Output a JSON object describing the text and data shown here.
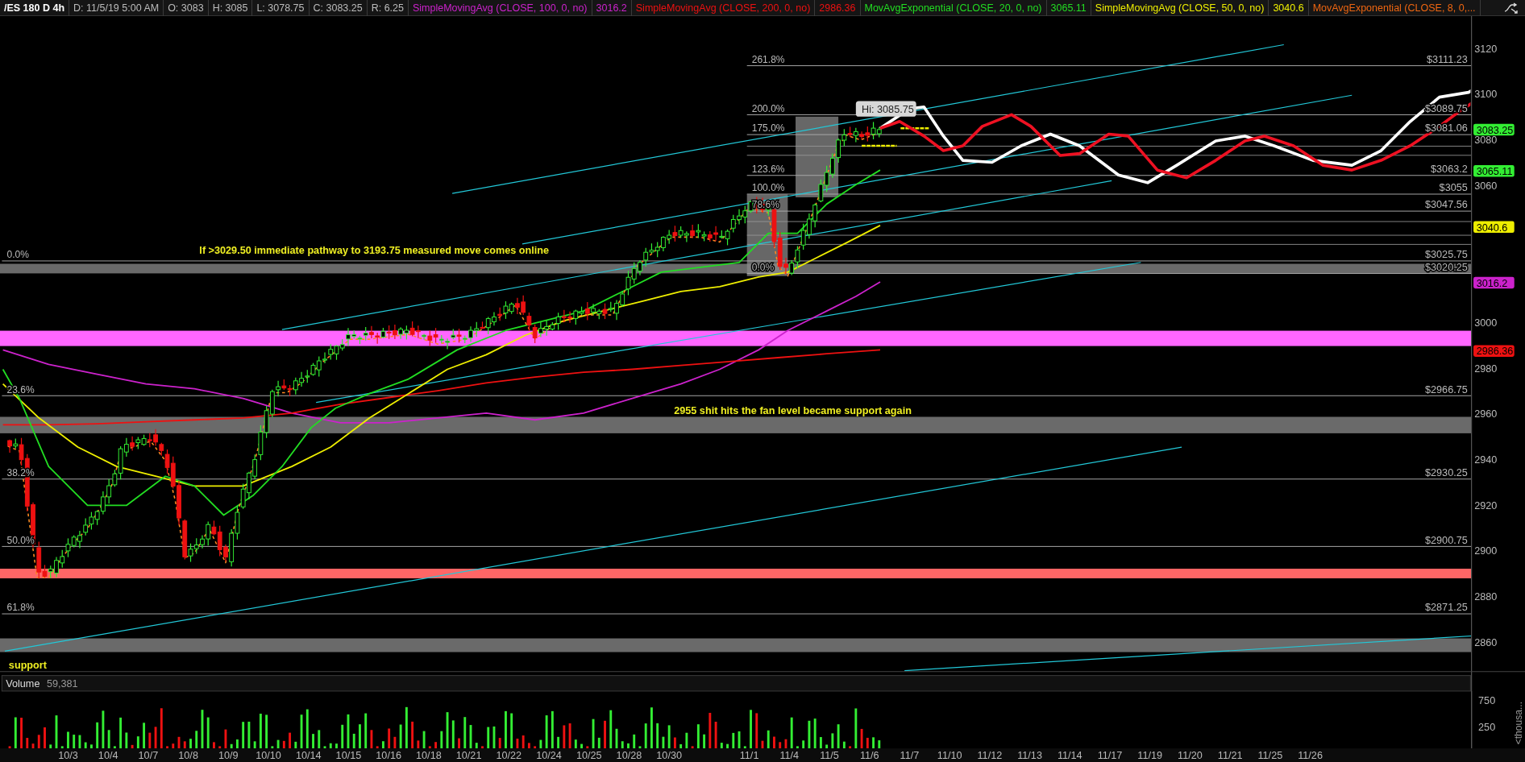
{
  "header": {
    "symbol": "/ES 180 D 4h",
    "fields": [
      "D: 11/5/19 5:00 AM",
      "O: 3083",
      "H: 3085",
      "L: 3078.75",
      "C: 3083.25",
      "R: 6.25"
    ],
    "studies": [
      {
        "label": "SimpleMovingAvg (CLOSE, 100, 0, no)",
        "value": "3016.2",
        "color": "#cc22cc"
      },
      {
        "label": "SimpleMovingAvg (CLOSE, 200, 0, no)",
        "value": "2986.36",
        "color": "#ee1111"
      },
      {
        "label": "MovAvgExponential (CLOSE, 20, 0, no)",
        "value": "3065.11",
        "color": "#22dd22"
      },
      {
        "label": "SimpleMovingAvg (CLOSE, 50, 0, no)",
        "value": "3040.6",
        "color": "#eeee00"
      },
      {
        "label": "MovAvgExponential (CLOSE, 8, 0,...",
        "color": "#ee6611"
      }
    ]
  },
  "fib_sets": [
    {
      "levels": [
        {
          "pct": "0.0%",
          "price": "$3025.75"
        },
        {
          "pct": "23.6%",
          "price": "$2966.75"
        },
        {
          "pct": "38.2%",
          "price": "$2930.25"
        },
        {
          "pct": "50.0%",
          "price": "$2900.75"
        },
        {
          "pct": "61.8%",
          "price": "$2871.25"
        }
      ]
    },
    {
      "levels": [
        {
          "pct": "261.8%",
          "price": "$3111.23"
        },
        {
          "pct": "200.0%",
          "price": "$3089.75"
        },
        {
          "pct": "175.0%",
          "price": "$3081.06"
        },
        {
          "pct": "123.6%",
          "price": "$3063.2"
        },
        {
          "pct": "100.0%",
          "price": "$3055"
        },
        {
          "pct": "78.6%",
          "price": "$3047.56"
        },
        {
          "pct": "0.0%",
          "price": "$3020.25"
        }
      ]
    }
  ],
  "annotations": [
    "If >3029.50 immediate pathway to 3193.75 measured move comes online",
    "2955 shit hits the fan level became support again",
    "support"
  ],
  "high_bubble": "Hi: 3085.75",
  "price_axis": {
    "ticks": [
      "3120",
      "3100",
      "3080",
      "3060",
      "3000",
      "2980",
      "2960",
      "2940",
      "2920",
      "2900",
      "2880",
      "2860"
    ]
  },
  "price_tags": [
    {
      "text": "3083.25",
      "color": "#33ee33"
    },
    {
      "text": "3065.11",
      "color": "#33ee33"
    },
    {
      "text": "3040.6",
      "color": "#eeee00"
    },
    {
      "text": "3016.2",
      "color": "#cc22cc"
    },
    {
      "text": "2986.36",
      "color": "#ee1111"
    }
  ],
  "volume": {
    "label": "Volume",
    "value": "59,381",
    "ticks": [
      "750",
      "250"
    ],
    "unit": "<thousa..."
  },
  "dates": [
    "10/3",
    "10/4",
    "10/7",
    "10/8",
    "10/9",
    "10/10",
    "10/14",
    "10/15",
    "10/16",
    "10/18",
    "10/21",
    "10/22",
    "10/24",
    "10/25",
    "10/28",
    "10/30",
    "11/1",
    "11/4",
    "11/5",
    "11/6",
    "11/7",
    "11/10",
    "11/12",
    "11/13",
    "11/14",
    "11/17",
    "11/19",
    "11/20",
    "11/21",
    "11/25",
    "11/26"
  ]
}
